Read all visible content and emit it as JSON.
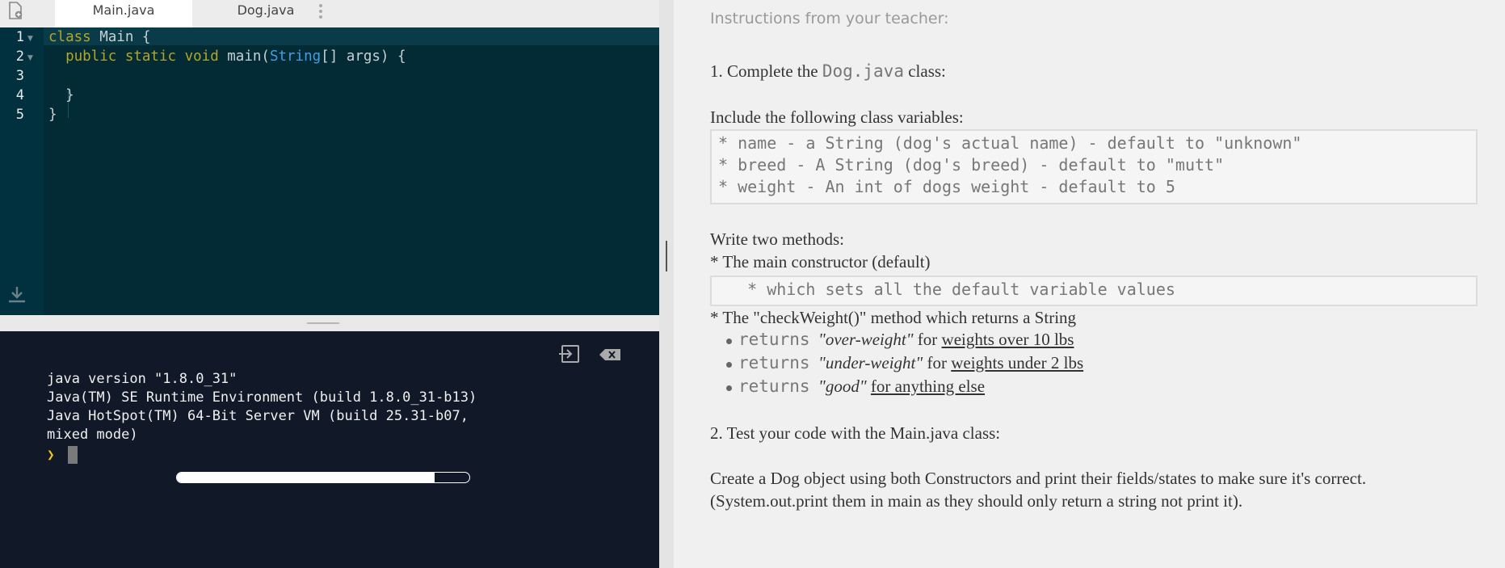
{
  "tabs": [
    {
      "label": "Main.java",
      "active": true
    },
    {
      "label": "Dog.java",
      "active": false
    }
  ],
  "editor": {
    "line_numbers": [
      "1",
      "2",
      "3",
      "4",
      "5"
    ],
    "lines": [
      {
        "kw": "class",
        "rest": " Main {"
      },
      {
        "indent": "  ",
        "kw": "public static void",
        "mid": " main(",
        "type": "String",
        "rest": "[] args) {"
      },
      {
        "rest": ""
      },
      {
        "rest": "  }"
      },
      {
        "rest": "}"
      }
    ]
  },
  "console": {
    "output_lines": [
      "java version \"1.8.0_31\"",
      "Java(TM) SE Runtime Environment (build 1.8.0_31-b13)",
      "Java HotSpot(TM) 64-Bit Server VM (build 25.31-b07,",
      "mixed mode)"
    ],
    "prompt_symbol": "❯",
    "progress": 0.88
  },
  "instructions": {
    "header": "Instructions from your teacher:",
    "step1_prefix": "1. Complete the ",
    "step1_code": "Dog.java",
    "step1_suffix": " class:",
    "vars_intro": "Include the following class variables:",
    "vars": [
      "* name - a String (dog's actual name) - default to \"unknown\"",
      "* breed - A String (dog's breed) - default to \"mutt\"",
      "* weight - An int of dogs weight - default to 5"
    ],
    "methods_intro": "Write two methods:",
    "method1": "* The main constructor (default)",
    "method1_detail": "   * which sets all the default variable values",
    "method2": "* The \"checkWeight()\" method which returns a String",
    "returns": [
      {
        "kw": "returns",
        "value": "\"over-weight\"",
        "for": " for ",
        "cond": "weights over 10 lbs"
      },
      {
        "kw": "returns",
        "value": "\"under-weight\"",
        "for": " for ",
        "cond": "weights under 2 lbs"
      },
      {
        "kw": "returns",
        "value": "\"good\"",
        "for": " ",
        "cond": "for anything else"
      }
    ],
    "step2": "2. Test your code with the Main.java class:",
    "final_line1": "Create a Dog object using both Constructors and print their fields/states to make sure it's correct.",
    "final_line2": "(System.out.print them in main as they should only return a string not print it)."
  },
  "colors": {
    "editor_bg": "#022b35",
    "console_bg": "#111827",
    "keyword": "#b4a626",
    "type": "#3fa0e5",
    "prompt": "#f5c518"
  }
}
